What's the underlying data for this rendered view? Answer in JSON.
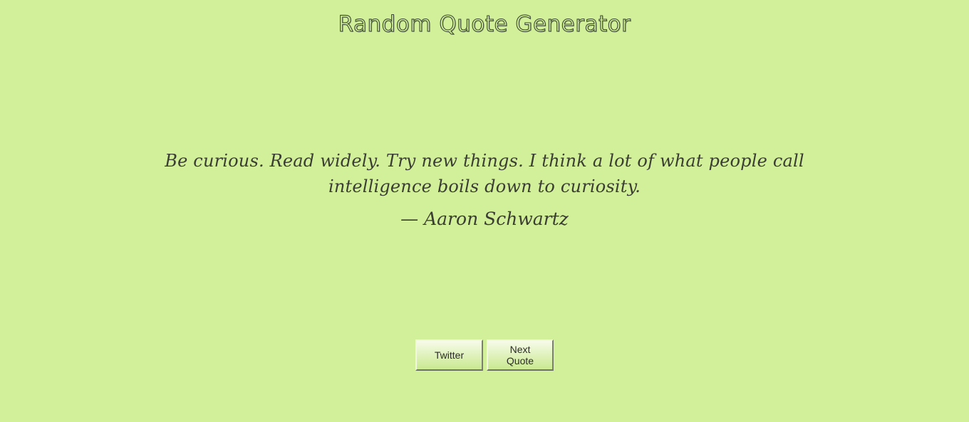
{
  "header": {
    "title": "Random Quote Generator"
  },
  "quote": {
    "text": "Be curious. Read widely. Try new things. I think a lot of what people call intelligence boils down to curiosity.",
    "author": "— Aaron Schwartz"
  },
  "actions": {
    "twitter_label": "Twitter",
    "next_label": "Next Quote"
  },
  "colors": {
    "background": "#d2ef9a",
    "text": "#3a3d32"
  }
}
